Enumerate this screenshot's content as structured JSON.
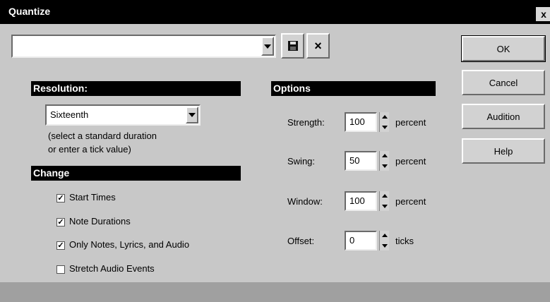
{
  "window": {
    "title": "Quantize",
    "close_glyph": "x"
  },
  "preset": {
    "value": "",
    "save_icon": "save-disk-icon",
    "delete_icon": "delete-x-icon",
    "delete_glyph": "×"
  },
  "buttons": {
    "ok": "OK",
    "cancel": "Cancel",
    "audition": "Audition",
    "help": "Help"
  },
  "resolution": {
    "header": "Resolution:",
    "value": "Sixteenth",
    "hint_line1": "(select a standard duration",
    "hint_line2": "or enter a tick value)"
  },
  "change": {
    "header": "Change",
    "items": [
      {
        "label": "Start Times",
        "checked": true,
        "mark": "✓"
      },
      {
        "label": "Note Durations",
        "checked": true,
        "mark": "✓"
      },
      {
        "label": "Only Notes, Lyrics, and Audio",
        "checked": true,
        "mark": "✓"
      },
      {
        "label": "Stretch Audio Events",
        "checked": false,
        "mark": ""
      }
    ]
  },
  "options": {
    "header": "Options",
    "fields": [
      {
        "label": "Strength:",
        "value": "100",
        "unit": "percent"
      },
      {
        "label": "Swing:",
        "value": "50",
        "unit": "percent"
      },
      {
        "label": "Window:",
        "value": "100",
        "unit": "percent"
      },
      {
        "label": "Offset:",
        "value": "0",
        "unit": "ticks"
      }
    ]
  }
}
